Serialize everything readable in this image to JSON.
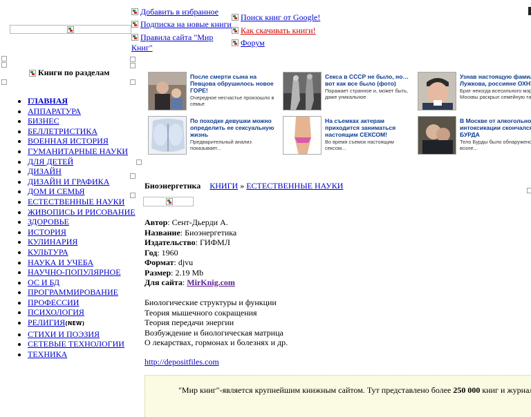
{
  "top_links": {
    "favorites": "Добавить в избранное",
    "subscribe": "Подписка на новые книги",
    "rules": "Правила сайта \"Мир Книг\"",
    "google_search": "Поиск книг от Google!",
    "how_download": "Как скачивать книги!",
    "forum": "Форум"
  },
  "sidebar": {
    "title": "Книги по разделам",
    "categories": [
      "Главная",
      "Аппаратура",
      "Бизнес",
      "Беллетристика",
      "Военная история",
      "Гуманитарные науки",
      "Для детей",
      "Дизайн",
      "Дизайн и графика",
      "Дом и семья",
      "Естественные науки",
      "Живопись и рисование",
      "Здоровье",
      "История",
      "Кулинария",
      "Культура",
      "Наука и учеба",
      "Научно-популярное",
      "ОС и БД",
      "Программирование",
      "Профессии",
      "Психология",
      "Религия",
      "Стихи и поэзия",
      "Сетевые технологии",
      "Техника"
    ],
    "new_badge": "NEW"
  },
  "ads": [
    {
      "headline": "После смерти сына на Певцова обрушилось новое ГОРЕ!",
      "desc": "Очередное несчастье произошло в семье"
    },
    {
      "headline": "Секса в СССР не было, но… вот как все было (фото)",
      "desc": "Поражает странное и, может быть, даже уникальное"
    },
    {
      "headline": "Узнав настоящую фамилию Лужкова, россияне ОХНУЛИ",
      "desc": "Брат некогда всесильного мэра Москвы раскрыл семейную тайну"
    },
    {
      "headline": "По походке девушки можно определить ее сексуальную жизнь",
      "desc": "Предварительный анализ показывает..."
    },
    {
      "headline": "На съемках актерам приходится заниматься настоящим СЕКСОМ!",
      "desc": "Во время съемок настоящим сексом..."
    },
    {
      "headline": "В Москве от алкогольной интоксикации скончался БУРДА",
      "desc": "Тело Бурды было обнаружено возле..."
    }
  ],
  "book": {
    "page_title": "Биоэнергетика",
    "crumb_books": "КНИГИ",
    "crumb_sep": "»",
    "crumb_category": "ЕСТЕСТВЕННЫЕ НАУКИ",
    "author_label": "Автор",
    "author": "Сент-Дьерди А.",
    "title_label": "Название",
    "title": "Биоэнергетика",
    "publisher_label": "Издательство",
    "publisher": "ГИФМЛ",
    "year_label": "Год",
    "year": "1960",
    "format_label": "Формат",
    "format": "djvu",
    "size_label": "Размер",
    "size": "2.19 Mb",
    "forsite_label": "Для сайта",
    "forsite": "MirKnig.com",
    "contents": [
      "Биологические структуры и функции",
      "Теория мышечного сокращения",
      "Теория передачи энергии",
      "Возбуждение и биологическая матрица",
      "О лекарствах, гормонах и болезнях и др."
    ],
    "download_link": "http://depositfiles.com"
  },
  "footer": {
    "text_start": "\"Мир книг\"-является крупнейшим книжным сайтом. Тут представлено более ",
    "count": "250 000",
    "text_end": " книг и журналов. Н"
  },
  "colors": {
    "link": "#0000cc",
    "link_red": "#cc0000",
    "ad_headline": "#0b3a91",
    "footer_bg": "#fbfbe3"
  }
}
